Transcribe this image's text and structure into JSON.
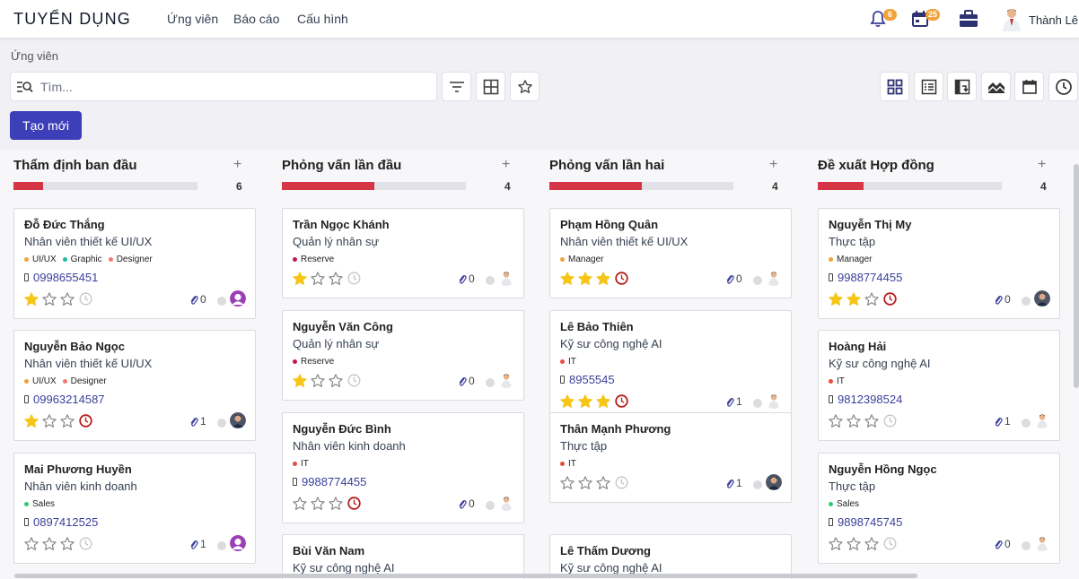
{
  "app": {
    "brand": "TUYỂN DỤNG",
    "menu": [
      "Ứng viên",
      "Báo cáo",
      "Cấu hình"
    ],
    "notifications_count": "6",
    "activities_count": "25",
    "user_name": "Thành Lê"
  },
  "breadcrumb": "Ứng viên",
  "search": {
    "placeholder": "Tìm..."
  },
  "toolbar": {
    "new_label": "Tạo mới"
  },
  "colors": {
    "accent": "#3c3fb8",
    "progress": "#d63545",
    "star": "#f5c518",
    "overdue": "#b91c1c",
    "badge": "#f0a23b"
  },
  "columns": [
    {
      "title": "Thẩm định ban đầu",
      "count": "6",
      "progress": 0.16,
      "cards": [
        {
          "name": "Đỗ Đức Thắng",
          "job": "Nhân viên thiết kế UI/UX",
          "tags": [
            {
              "label": "UI/UX",
              "color": "#f0a23b"
            },
            {
              "label": "Graphic",
              "color": "#1abc9c"
            },
            {
              "label": "Designer",
              "color": "#f07b6d"
            }
          ],
          "phone": "0998655451",
          "stars": 1,
          "clock": "gray",
          "attachments": "0",
          "avatar": "purple"
        },
        {
          "name": "Nguyễn Bảo Ngọc",
          "job": "Nhân viên thiết kế UI/UX",
          "tags": [
            {
              "label": "UI/UX",
              "color": "#f0a23b"
            },
            {
              "label": "Designer",
              "color": "#f07b6d"
            }
          ],
          "phone": "09963214587",
          "stars": 1,
          "clock": "red",
          "attachments": "1",
          "avatar": "photo"
        },
        {
          "name": "Mai Phương Huyền",
          "job": "Nhân viên kinh doanh",
          "tags": [
            {
              "label": "Sales",
              "color": "#2ecc71"
            }
          ],
          "phone": "0897412525",
          "stars": 0,
          "clock": "gray",
          "attachments": "1",
          "avatar": "purple"
        }
      ]
    },
    {
      "title": "Phỏng vấn lần đầu",
      "count": "4",
      "progress": 0.5,
      "cards": [
        {
          "name": "Trần Ngọc Khánh",
          "job": "Quản lý nhân sự",
          "tags": [
            {
              "label": "Reserve",
              "color": "#c2185b"
            }
          ],
          "phone": "",
          "stars": 1,
          "clock": "gray",
          "attachments": "0",
          "avatar": "person"
        },
        {
          "name": "Nguyễn Văn Công",
          "job": "Quản lý nhân sự",
          "tags": [
            {
              "label": "Reserve",
              "color": "#c2185b"
            }
          ],
          "phone": "",
          "stars": 1,
          "clock": "gray",
          "attachments": "0",
          "avatar": "person"
        },
        {
          "name": "Nguyễn Đức Bình",
          "job": "Nhân viên kinh doanh",
          "tags": [
            {
              "label": "IT",
              "color": "#e74c3c"
            }
          ],
          "phone": "9988774455",
          "stars": 0,
          "clock": "red",
          "attachments": "0",
          "avatar": "person"
        },
        {
          "name": "Bùi Văn Nam",
          "job": "Kỹ sư công nghệ AI",
          "tags": [],
          "phone": "",
          "stars": 0,
          "clock": "none",
          "attachments": "",
          "avatar": "none"
        }
      ]
    },
    {
      "title": "Phỏng vấn lần hai",
      "count": "4",
      "progress": 0.5,
      "cards": [
        {
          "name": "Phạm Hồng Quân",
          "job": "Nhân viên thiết kế UI/UX",
          "tags": [
            {
              "label": "Manager",
              "color": "#f0a23b"
            }
          ],
          "phone": "",
          "stars": 3,
          "clock": "red",
          "attachments": "0",
          "avatar": "person"
        },
        {
          "name": "Lê Bảo Thiên",
          "job": "Kỹ sư công nghệ AI",
          "tags": [
            {
              "label": "IT",
              "color": "#e74c3c"
            }
          ],
          "phone": "8955545",
          "stars": 3,
          "clock": "red",
          "attachments": "1",
          "avatar": "person"
        },
        {
          "name": "Thân Mạnh Phương",
          "job": "Thực tập",
          "tags": [
            {
              "label": "IT",
              "color": "#e74c3c"
            }
          ],
          "phone": "",
          "stars": 0,
          "clock": "gray",
          "attachments": "1",
          "avatar": "photo"
        },
        {
          "name": "Lê Thấm Dương",
          "job": "Kỹ sư công nghệ AI",
          "tags": [],
          "phone": "",
          "stars": 0,
          "clock": "none",
          "attachments": "",
          "avatar": "none"
        }
      ]
    },
    {
      "title": "Đề xuất Hợp đồng",
      "count": "4",
      "progress": 0.25,
      "cards": [
        {
          "name": "Nguyễn Thị My",
          "job": "Thực tập",
          "tags": [
            {
              "label": "Manager",
              "color": "#f0a23b"
            }
          ],
          "phone": "9988774455",
          "stars": 2,
          "clock": "red",
          "attachments": "0",
          "avatar": "photo"
        },
        {
          "name": "Hoàng Hải",
          "job": "Kỹ sư công nghệ AI",
          "tags": [
            {
              "label": "IT",
              "color": "#e74c3c"
            }
          ],
          "phone": "9812398524",
          "stars": 0,
          "clock": "gray",
          "attachments": "1",
          "avatar": "person"
        },
        {
          "name": "Nguyễn Hồng Ngọc",
          "job": "Thực tập",
          "tags": [
            {
              "label": "Sales",
              "color": "#2ecc71"
            }
          ],
          "phone": "9898745745",
          "stars": 0,
          "clock": "gray",
          "attachments": "0",
          "avatar": "person"
        }
      ]
    }
  ]
}
